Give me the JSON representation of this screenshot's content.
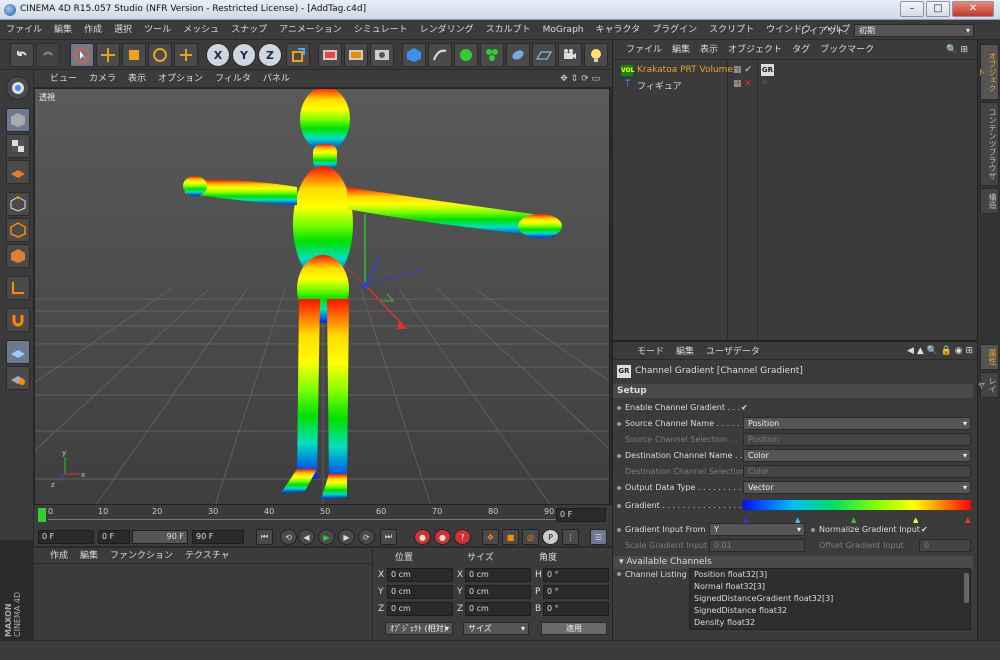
{
  "window": {
    "title": "CINEMA 4D R15.057 Studio (NFR Version - Restricted License) - [AddTag.c4d]"
  },
  "menubar": [
    "ファイル",
    "編集",
    "作成",
    "選択",
    "ツール",
    "メッシュ",
    "スナップ",
    "アニメーション",
    "シミュレート",
    "レンダリング",
    "スカルプト",
    "MoGraph",
    "キャラクタ",
    "プラグイン",
    "スクリプト",
    "ウインドウ",
    "ヘルプ"
  ],
  "layout": {
    "label": "レイアウト:",
    "value": "初期"
  },
  "viewport": {
    "menu": [
      "ビュー",
      "カメラ",
      "表示",
      "オプション",
      "フィルタ",
      "パネル"
    ],
    "label": "透視"
  },
  "timeline": {
    "ticks": [
      "0",
      "10",
      "20",
      "30",
      "40",
      "50",
      "60",
      "70",
      "80",
      "90"
    ],
    "end_field": "0 F"
  },
  "transport": {
    "current": "0 F",
    "min": "0 F",
    "max": "90 F",
    "end": "90 F"
  },
  "material_panel": {
    "menu": [
      "作成",
      "編集",
      "ファンクション",
      "テクスチャ"
    ]
  },
  "coords": {
    "headers": [
      "位置",
      "サイズ",
      "角度"
    ],
    "rows": [
      {
        "a": "X",
        "pos": "0 cm",
        "b": "X",
        "size": "0 cm",
        "c": "H",
        "rot": "0 °"
      },
      {
        "a": "Y",
        "pos": "0 cm",
        "b": "Y",
        "size": "0 cm",
        "c": "P",
        "rot": "0 °"
      },
      {
        "a": "Z",
        "pos": "0 cm",
        "b": "Z",
        "size": "0 cm",
        "c": "B",
        "rot": "0 °"
      }
    ],
    "mode1": "ｵﾌﾞｼﾞｪｸﾄ (相対)",
    "mode2": "サイズ",
    "apply": "適用"
  },
  "object_manager": {
    "menu": [
      "ファイル",
      "編集",
      "表示",
      "オブジェクト",
      "タグ",
      "ブックマーク"
    ],
    "objects": [
      {
        "name": "Krakatoa PRT Volume",
        "color": "#e8a030",
        "tag": "GR"
      },
      {
        "name": "フィギュア",
        "color": "#cccccc",
        "tag": ""
      }
    ]
  },
  "attribute_manager": {
    "menu": [
      "モード",
      "編集",
      "ユーザデータ"
    ],
    "title": "Channel Gradient [Channel Gradient]",
    "section": "Setup",
    "rows": [
      {
        "label": "Enable Channel Gradient . . . .",
        "value": "✔",
        "kind": "check"
      },
      {
        "label": "Source Channel Name . . . . . .",
        "value": "Position",
        "kind": "dropdown"
      },
      {
        "label": "Source Channel Selection . .",
        "value": "Position",
        "kind": "disabled"
      },
      {
        "label": "Destination Channel Name . .",
        "value": "Color",
        "kind": "dropdown"
      },
      {
        "label": "Destination Channel Selection",
        "value": "Color",
        "kind": "disabled"
      },
      {
        "label": "Output Data Type . . . . . . . . .",
        "value": "Vector",
        "kind": "dropdown"
      },
      {
        "label": "Gradient . . . . . . . . . . . . . . . .",
        "value": "",
        "kind": "gradient"
      }
    ],
    "gradient_from": {
      "label": "Gradient Input From",
      "value": "Y"
    },
    "normalize": {
      "label": "Normalize Gradient Input",
      "value": "✔"
    },
    "scale": {
      "label": "Scale Gradient Input",
      "value": "0.01"
    },
    "offset": {
      "label": "Offset Gradient Input",
      "value": "0"
    },
    "available_label": "Available Channels",
    "listing_label": "Channel Listing",
    "channels": [
      "Position float32[3]",
      "Normal float32[3]",
      "SignedDistanceGradient float32[3]",
      "SignedDistance float32",
      "Density float32"
    ]
  },
  "side_tabs": [
    "オブジェクト",
    "コンテンツブラウザ",
    "構造",
    "属性",
    "レイヤ"
  ],
  "brand": {
    "line1": "MAXON",
    "line2": "CINEMA 4D"
  }
}
